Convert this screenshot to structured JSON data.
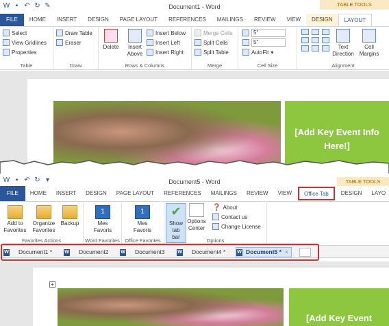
{
  "top": {
    "window_title": "Document1 - Word",
    "context_label": "TABLE TOOLS",
    "tabs": [
      "FILE",
      "HOME",
      "INSERT",
      "DESIGN",
      "PAGE LAYOUT",
      "REFERENCES",
      "MAILINGS",
      "REVIEW",
      "VIEW",
      "DESIGN",
      "LAYOUT"
    ],
    "table_group": {
      "select": "Select",
      "view_gridlines": "View Gridlines",
      "properties": "Properties",
      "label": "Table"
    },
    "draw_group": {
      "draw_table": "Draw Table",
      "eraser": "Eraser",
      "label": "Draw"
    },
    "rows_group": {
      "delete": "Delete",
      "insert_above": "Insert Above",
      "insert_below": "Insert Below",
      "insert_left": "Insert Left",
      "insert_right": "Insert Right",
      "label": "Rows & Columns"
    },
    "merge_group": {
      "merge_cells": "Merge Cells",
      "split_cells": "Split Cells",
      "split_table": "Split Table",
      "label": "Merge"
    },
    "cellsize_group": {
      "height": "5\"",
      "width": "5\"",
      "autofit": "AutoFit",
      "label": "Cell Size"
    },
    "align_group": {
      "text_direction": "Text Direction",
      "cell_margins": "Cell Margins",
      "label": "Alignment"
    },
    "banner_text": "[Add Key Event Info Here!]"
  },
  "bottom": {
    "window_title": "Document5 - Word",
    "context_label": "TABLE TOOLS",
    "tabs": [
      "FILE",
      "HOME",
      "INSERT",
      "DESIGN",
      "PAGE LAYOUT",
      "REFERENCES",
      "MAILINGS",
      "REVIEW",
      "VIEW",
      "Office Tab",
      "DESIGN",
      "LAYO"
    ],
    "fav_group": {
      "add": "Add to Favorites",
      "organize": "Organize Favorites",
      "backup": "Backup",
      "label": "Favorites Actions"
    },
    "word_fav": {
      "mes": "Mes Favoris",
      "label": "Word Favorites"
    },
    "office_fav": {
      "mes": "Mes Favoris",
      "label": "Office Favorites"
    },
    "options_group": {
      "show_tab_bar": "Show tab bar",
      "options_center": "Options Center",
      "about": "About",
      "contact": "Contact us",
      "change_license": "Change License",
      "label": "Options"
    },
    "doc_tabs": [
      {
        "name": "Document1 *"
      },
      {
        "name": "Document2"
      },
      {
        "name": "Document3"
      },
      {
        "name": "Document4 *"
      },
      {
        "name": "Document5 *",
        "close": "×"
      }
    ],
    "banner_text": "[Add Key Event"
  },
  "colors": {
    "accent": "#2b579a",
    "green": "#8dc73f",
    "red_highlight": "#d02f2f"
  }
}
